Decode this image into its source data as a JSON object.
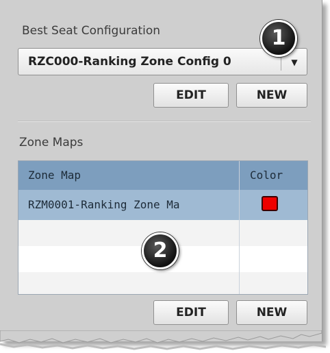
{
  "best_seat": {
    "label": "Best Seat Configuration",
    "selected_config": "RZC000-Ranking Zone Config 0",
    "edit_label": "EDIT",
    "new_label": "NEW"
  },
  "zone_maps": {
    "label": "Zone Maps",
    "columns": [
      "Zone Map",
      "Color"
    ],
    "rows": [
      {
        "name": "RZM0001-Ranking Zone Ma",
        "color": "#ee0000"
      }
    ],
    "edit_label": "EDIT",
    "new_label": "NEW"
  },
  "callouts": [
    "1",
    "2"
  ],
  "colors": {
    "panel_bg": "#cfcfcf",
    "header_bg": "#7d9ebe",
    "selected_row_bg": "#9fbad3"
  }
}
